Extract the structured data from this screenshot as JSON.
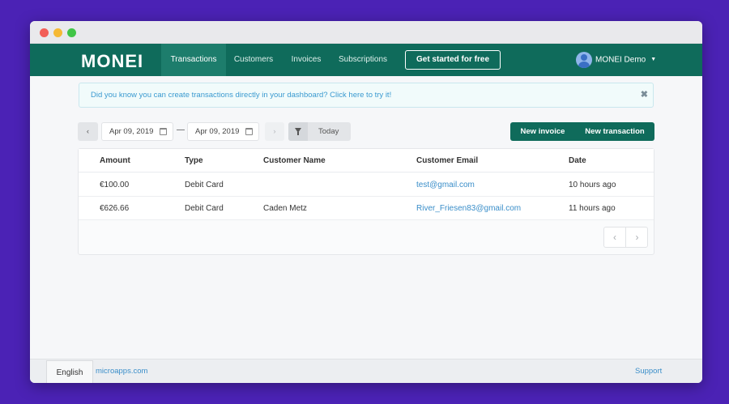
{
  "window": {
    "controls": [
      "close",
      "minimize",
      "maximize"
    ]
  },
  "navbar": {
    "logo": "MONEI",
    "items": [
      {
        "label": "Transactions",
        "active": true
      },
      {
        "label": "Customers",
        "active": false
      },
      {
        "label": "Invoices",
        "active": false
      },
      {
        "label": "Subscriptions",
        "active": false
      }
    ],
    "cta_label": "Get started for free",
    "user_name": "MONEI Demo",
    "user_caret": "▼",
    "brand_color": "#0f6b5b"
  },
  "banner": {
    "text": "Did you know you can create transactions directly in your dashboard? Click here to try it!",
    "close_glyph": "✖"
  },
  "filters": {
    "prev_glyph": "‹",
    "next_glyph": "›",
    "date_from": "Apr 09, 2019",
    "date_to": "Apr 09, 2019",
    "separator": "—",
    "today_label": "Today",
    "icons": {
      "calendar": "calendar-icon",
      "filter": "funnel-icon"
    }
  },
  "actions": {
    "new_invoice": "New invoice",
    "new_transaction": "New transaction"
  },
  "table": {
    "columns": [
      "Amount",
      "Type",
      "Customer Name",
      "Customer Email",
      "Date"
    ],
    "rows": [
      {
        "amount": "€100.00",
        "type": "Debit Card",
        "customer_name": "",
        "customer_email": "test@gmail.com",
        "date": "10 hours ago"
      },
      {
        "amount": "€626.66",
        "type": "Debit Card",
        "customer_name": "Caden Metz",
        "customer_email": "River_Friesen83@gmail.com",
        "date": "11 hours ago"
      }
    ],
    "pager": {
      "prev_glyph": "‹",
      "next_glyph": "›"
    }
  },
  "footer": {
    "language": "English",
    "link_left": "microapps.com",
    "link_right": "Support"
  }
}
